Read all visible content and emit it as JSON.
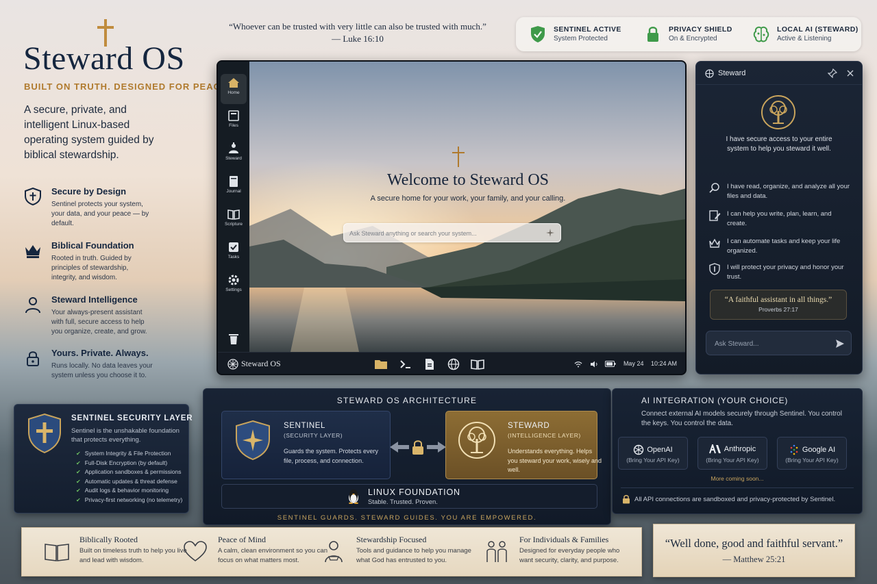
{
  "brand": {
    "title": "Steward OS",
    "tagline": "BUILT ON TRUTH. DESIGNED FOR PEACE.",
    "description": "A secure, private, and intelligent Linux-based operating system guided by biblical stewardship."
  },
  "features": [
    {
      "icon": "shield-cross-icon",
      "title": "Secure by Design",
      "desc": "Sentinel protects your system, your data, and your peace — by default."
    },
    {
      "icon": "crown-icon",
      "title": "Biblical Foundation",
      "desc": "Rooted in truth. Guided by principles of stewardship, integrity, and wisdom."
    },
    {
      "icon": "person-icon",
      "title": "Steward Intelligence",
      "desc": "Your always-present assistant with full, secure access to help you organize, create, and grow."
    },
    {
      "icon": "lock-icon",
      "title": "Yours. Private. Always.",
      "desc": "Runs locally. No data leaves your system unless you choose it to."
    }
  ],
  "sentinel_card": {
    "title": "SENTINEL SECURITY LAYER",
    "desc": "Sentinel is the unshakable foundation that protects everything.",
    "items": [
      "System Integrity & File Protection",
      "Full-Disk Encryption (by default)",
      "Application sandboxes & permissions",
      "Automatic updates & threat defense",
      "Audit logs & behavior monitoring",
      "Privacy-first networking (no telemetry)"
    ]
  },
  "top_quote": {
    "text": "“Whoever can be trusted with very little can also be trusted with much.”",
    "ref": "— Luke 16:10"
  },
  "status": [
    {
      "icon": "shield-check-icon",
      "title": "SENTINEL ACTIVE",
      "sub": "System Protected",
      "color": "#3f9a4a"
    },
    {
      "icon": "padlock-icon",
      "title": "PRIVACY SHIELD",
      "sub": "On & Encrypted",
      "color": "#3f9a4a"
    },
    {
      "icon": "brain-icon",
      "title": "LOCAL AI (STEWARD)",
      "sub": "Active & Listening",
      "color": "#3f9a4a"
    }
  ],
  "desktop": {
    "dock": [
      {
        "icon": "home-icon",
        "label": "Home"
      },
      {
        "icon": "files-icon",
        "label": "Files"
      },
      {
        "icon": "steward-icon",
        "label": "Steward"
      },
      {
        "icon": "journal-icon",
        "label": "Journal"
      },
      {
        "icon": "scripture-icon",
        "label": "Scripture"
      },
      {
        "icon": "tasks-icon",
        "label": "Tasks"
      },
      {
        "icon": "settings-icon",
        "label": "Settings"
      }
    ],
    "welcome_title": "Welcome to Steward OS",
    "welcome_sub": "A secure home for your work, your family, and your calling.",
    "search_placeholder": "Ask Steward anything or search your system...",
    "taskbar": {
      "name": "Steward OS",
      "date": "May 24",
      "time": "10:24 AM"
    }
  },
  "steward_panel": {
    "title": "Steward",
    "intro": "I have secure access to your entire system to help you steward it well.",
    "capabilities": [
      {
        "icon": "search-icon",
        "text": "I have read, organize, and analyze all your files and data."
      },
      {
        "icon": "edit-icon",
        "text": "I can help you write, plan, learn, and create."
      },
      {
        "icon": "automate-icon",
        "text": "I can automate tasks and keep your life organized."
      },
      {
        "icon": "shield-icon",
        "text": "I will protect your privacy and honor your trust."
      }
    ],
    "quote": "“A faithful assistant in all things.”",
    "quote_ref": "Proverbs 27:17",
    "input_placeholder": "Ask Steward..."
  },
  "architecture": {
    "title": "STEWARD OS ARCHITECTURE",
    "sentinel": {
      "name": "SENTINEL",
      "sub": "(SECURITY LAYER)",
      "desc": "Guards the system. Protects every file, process, and connection."
    },
    "steward": {
      "name": "STEWARD",
      "sub": "(INTELLIGENCE LAYER)",
      "desc": "Understands everything. Helps you steward your work, wisely and well."
    },
    "linux": {
      "title": "LINUX FOUNDATION",
      "sub": "Stable. Trusted. Proven."
    },
    "motto": "SENTINEL GUARDS. STEWARD GUIDES. YOU ARE EMPOWERED."
  },
  "ai_integration": {
    "title": "AI INTEGRATION (YOUR CHOICE)",
    "desc": "Connect external AI models securely through Sentinel. You control the keys. You control the data.",
    "providers": [
      {
        "name": "OpenAI",
        "sub": "(Bring Your API Key)",
        "icon": "openai-icon"
      },
      {
        "name": "Anthropic",
        "sub": "(Bring Your API Key)",
        "icon": "anthropic-icon"
      },
      {
        "name": "Google AI",
        "sub": "(Bring Your API Key)",
        "icon": "google-ai-icon"
      }
    ],
    "more": "More coming soon...",
    "footer": "All API connections are sandboxed and privacy-protected by Sentinel."
  },
  "values": [
    {
      "icon": "book-icon",
      "title": "Biblically Rooted",
      "desc": "Built on timeless truth to help you live and lead with wisdom."
    },
    {
      "icon": "heart-icon",
      "title": "Peace of Mind",
      "desc": "A calm, clean environment so you can focus on what matters most."
    },
    {
      "icon": "steward-person-icon",
      "title": "Stewardship Focused",
      "desc": "Tools and guidance to help you manage what God has entrusted to you."
    },
    {
      "icon": "family-icon",
      "title": "For Individuals & Families",
      "desc": "Designed for everyday people who want security, clarity, and purpose."
    }
  ],
  "final_quote": {
    "text": "“Well done, good and faithful servant.”",
    "ref": "— Matthew 25:21"
  },
  "colors": {
    "gold": "#b07a2d",
    "navy": "#15263f",
    "panel": "#182334",
    "status_green": "#3f9a4a"
  }
}
